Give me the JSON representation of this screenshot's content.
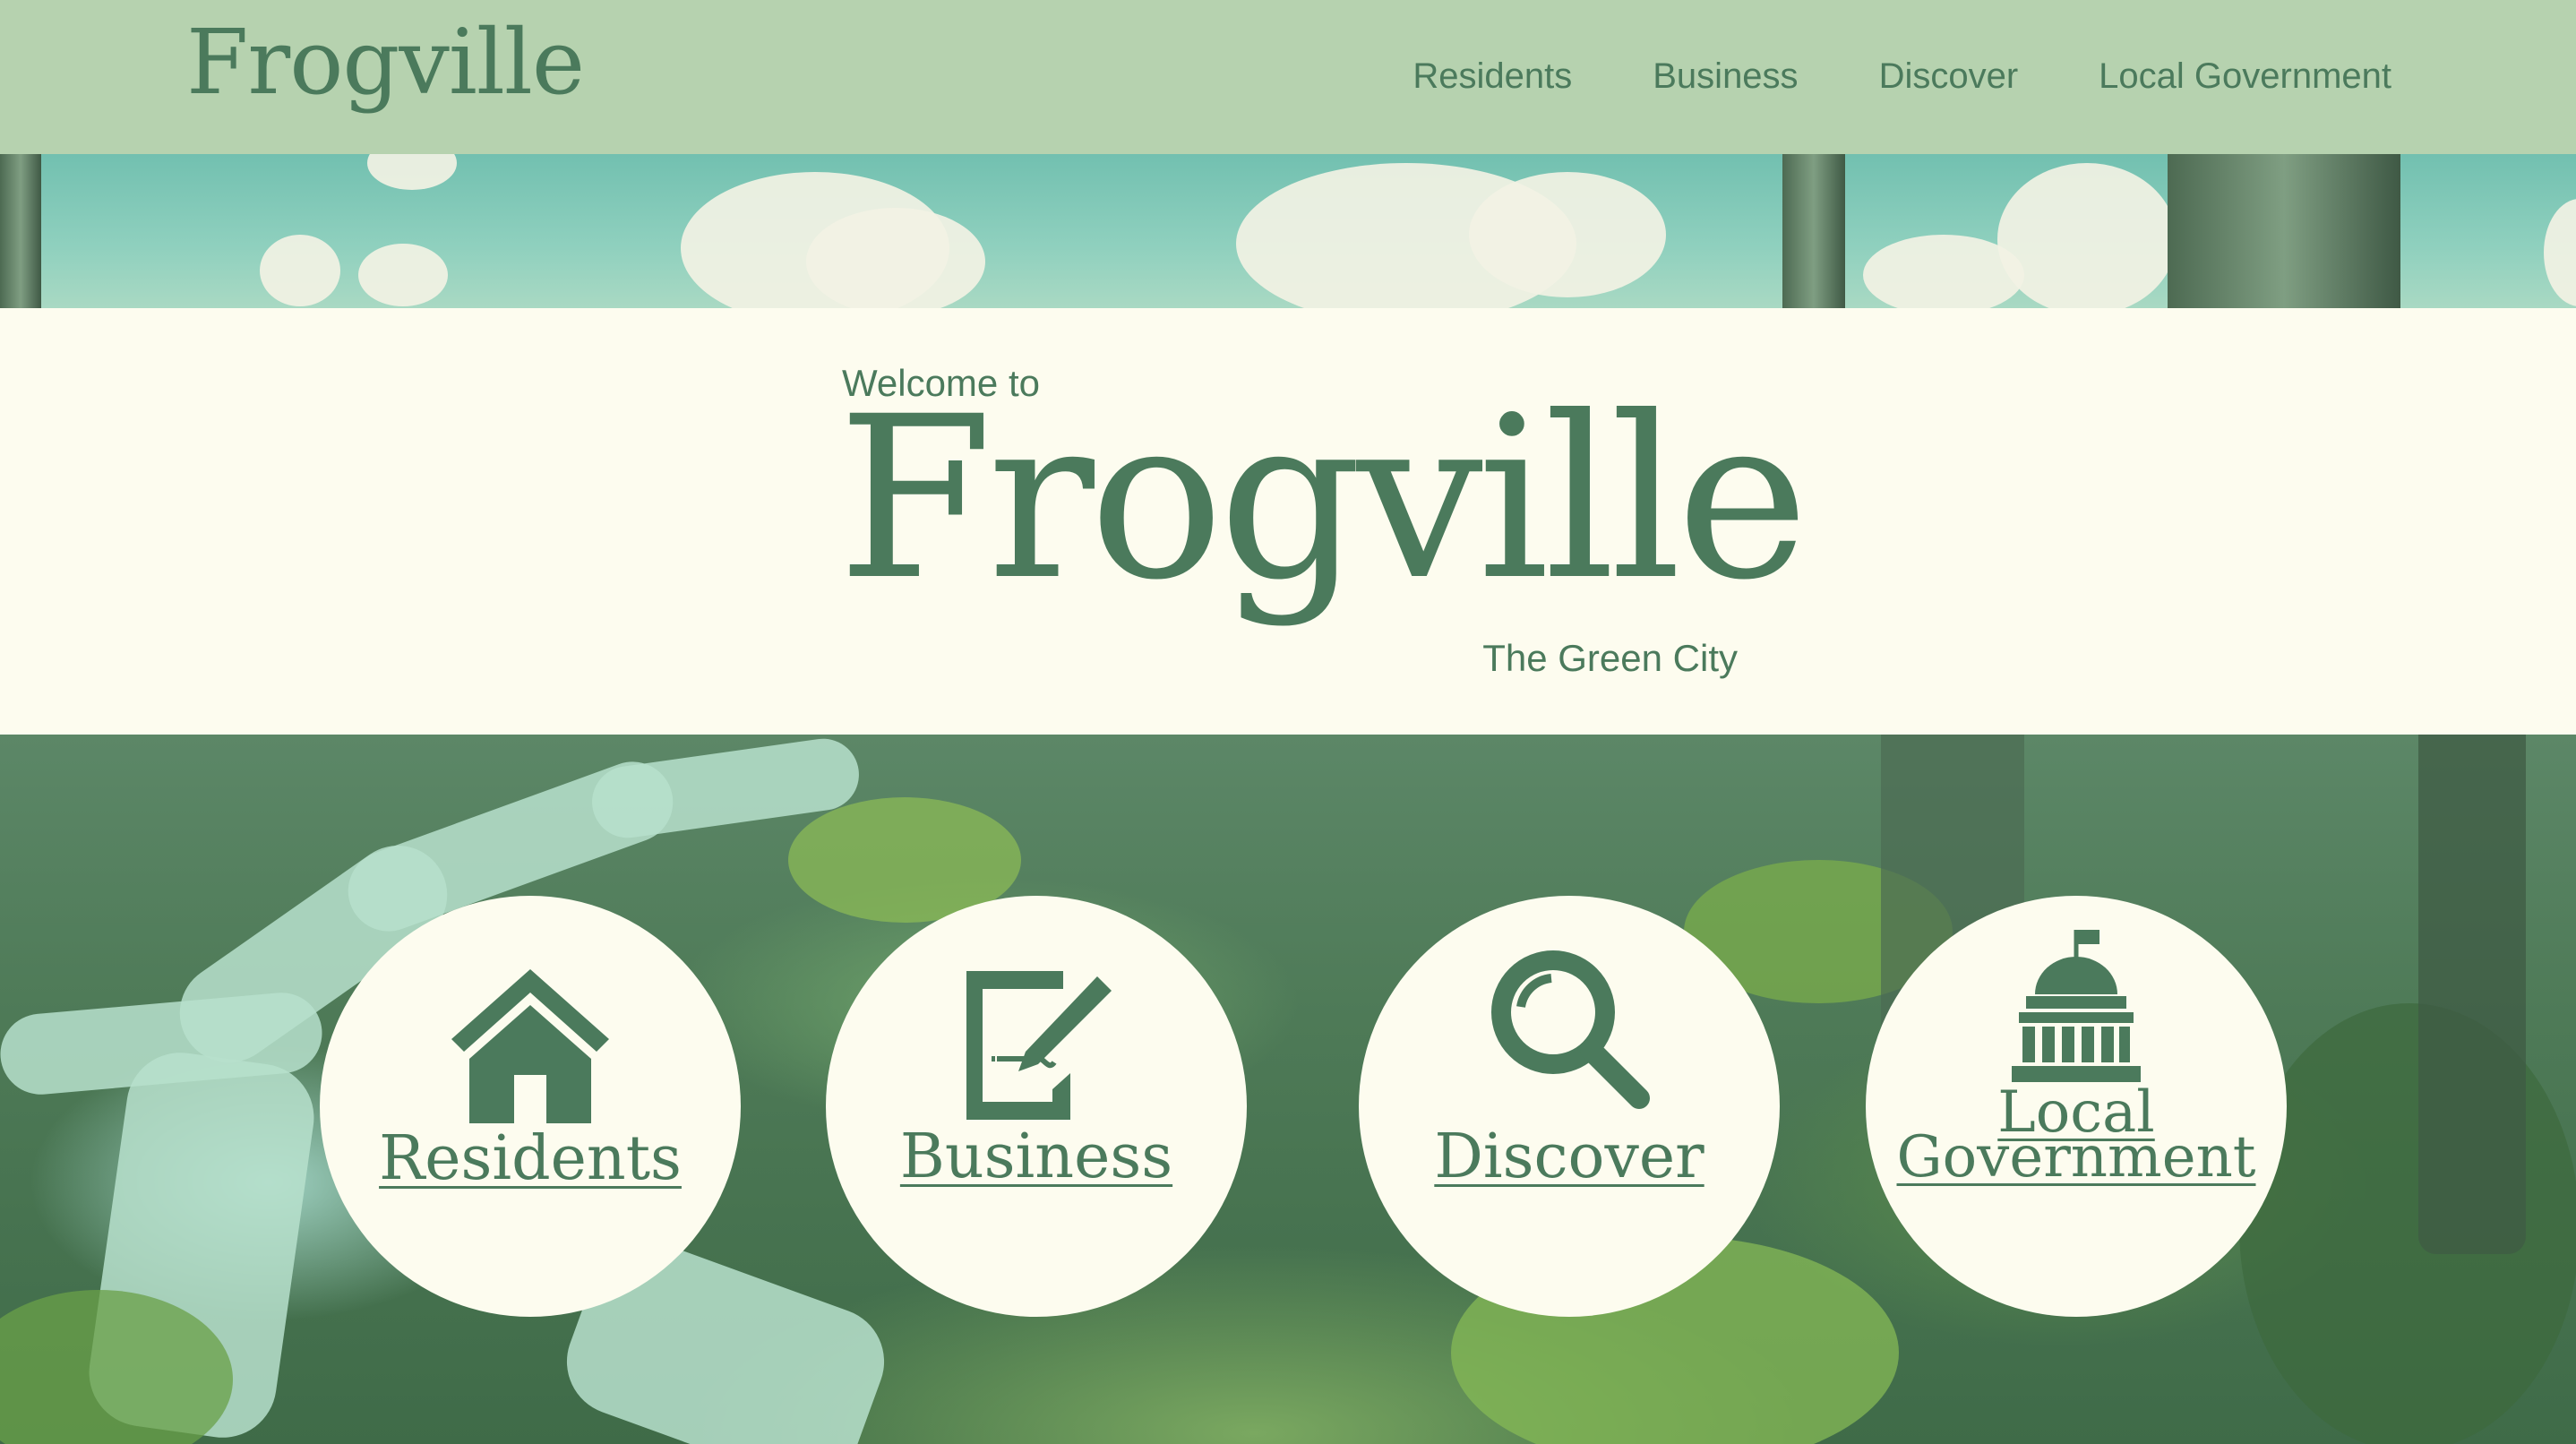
{
  "header": {
    "logo": "Frogville",
    "nav": [
      "Residents",
      "Business",
      "Discover",
      "Local Government"
    ]
  },
  "hero": {
    "welcome": "Welcome to",
    "title": "Frogville",
    "tagline": "The Green City"
  },
  "cards": [
    {
      "label": "Residents",
      "icon": "house-icon"
    },
    {
      "label": "Business",
      "icon": "document-pen-icon"
    },
    {
      "label": "Discover",
      "icon": "magnifier-icon"
    },
    {
      "label_line1": "Local",
      "label_line2": "Government",
      "icon": "capitol-building-icon"
    }
  ],
  "colors": {
    "brand_green": "#4b7a5c",
    "header_bg": "#b6d2af",
    "cream": "#fdfcef"
  }
}
